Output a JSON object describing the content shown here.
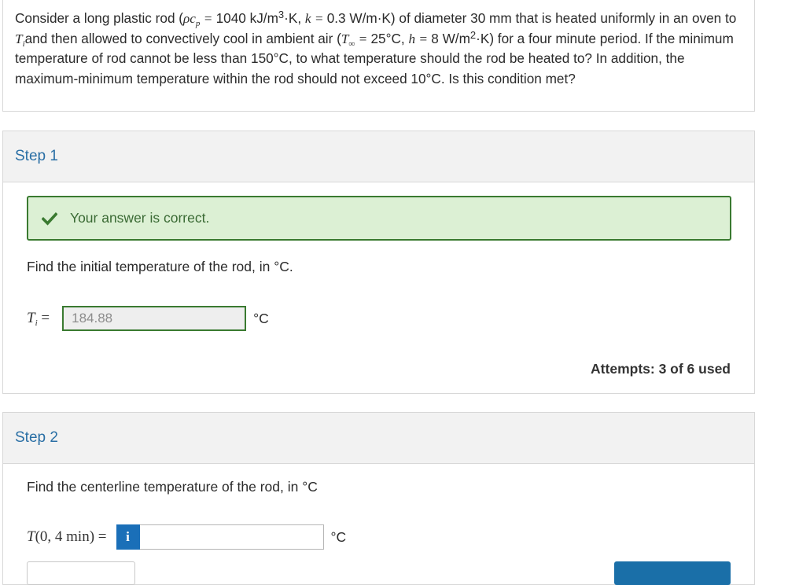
{
  "problem": {
    "part1": "Consider a long plastic rod (",
    "rho_cp_sym": "ρc",
    "rho_cp_sub": "p",
    "rho_cp_eq": " = ",
    "rho_cp_val": "1040 kJ/m",
    "rho_cp_sup": "3",
    "rho_cp_unit_tail": "·K, ",
    "k_sym": "k",
    "k_eq": " = ",
    "k_val": "0.3 W/m·K) of diameter 30 mm that is heated uniformly in an oven to ",
    "ti_sym": "T",
    "ti_sub": "i",
    "part2": "and then allowed to convectively cool in ambient air (",
    "tinf_sym": "T",
    "tinf_sub": "∞",
    "tinf_eq": " = ",
    "tinf_val": "25°C, ",
    "h_sym": "h",
    "h_eq": " = ",
    "h_val": "8 W/m",
    "h_sup": "2",
    "part3": "·K) for a four minute period. If the minimum temperature of rod cannot be less than 150°C, to what temperature should the rod be heated to? In addition, the maximum-minimum temperature within the rod should not exceed 10°C. Is this condition met?"
  },
  "step1": {
    "title": "Step 1",
    "success_message": "Your answer is correct.",
    "prompt": "Find the initial temperature of the rod, in °C.",
    "var_symbol": "T",
    "var_subscript": "i",
    "var_eq": " =",
    "value": "184.88",
    "unit": "°C",
    "attempts": "Attempts: 3 of 6 used"
  },
  "step2": {
    "title": "Step 2",
    "prompt": "Find the centerline temperature of the rod, in °C",
    "var_label": "T",
    "var_args": "(0, 4 min) =",
    "info_icon_glyph": "i",
    "value": "",
    "unit": "°C"
  },
  "colors": {
    "step_title": "#2a6fa5",
    "success_border": "#3a7a30",
    "success_bg": "#dcf0d4",
    "info_button": "#1a6fb8"
  }
}
